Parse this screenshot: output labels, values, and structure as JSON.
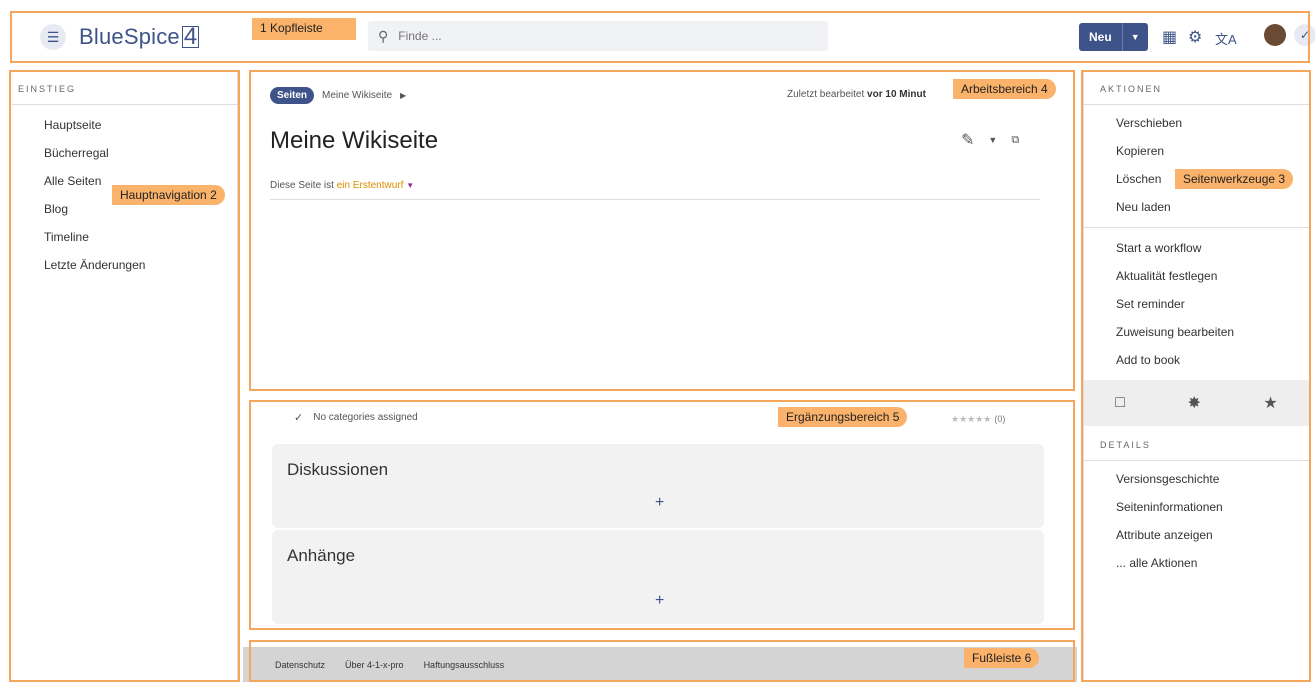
{
  "header": {
    "menu_icon": "hamburger-icon",
    "logo_text": "BlueSpice",
    "logo_number": "4",
    "search_placeholder": "Finde ...",
    "new_button": "Neu",
    "icons": [
      "apps-grid-icon",
      "gear-icon",
      "translate-icon",
      "avatar",
      "wrench-icon"
    ]
  },
  "callouts": {
    "c1": "1 Kopfleiste",
    "c2": "Hauptnavigation 2",
    "c3": "Seitenwerkzeuge 3",
    "c4": "Arbeitsbereich 4",
    "c5": "Ergänzungsbereich 5",
    "c6": "Fußleiste 6"
  },
  "left_nav": {
    "heading": "EINSTIEG",
    "items": [
      "Hauptseite",
      "Bücherregal",
      "Alle Seiten",
      "Blog",
      "Timeline",
      "Letzte Änderungen"
    ]
  },
  "main": {
    "breadcrumb_pill": "Seiten",
    "breadcrumb_page": "Meine Wikiseite",
    "last_edited_prefix": "Zuletzt bearbeitet",
    "last_edited_value": "vor 10 Minut",
    "title": "Meine Wikiseite",
    "status_prefix": "Diese Seite ist",
    "status_value": "ein Erstentwurf",
    "categories": "No categories assigned",
    "rating_count": "(0)",
    "rating_stars": 0,
    "panels": [
      {
        "title": "Diskussionen",
        "add": "+"
      },
      {
        "title": "Anhänge",
        "add": "+"
      }
    ]
  },
  "footer": {
    "links": [
      "Datenschutz",
      "Über 4-1-x-pro",
      "Haftungsausschluss"
    ]
  },
  "right": {
    "actions_heading": "AKTIONEN",
    "actions_group1": [
      "Verschieben",
      "Kopieren",
      "Löschen",
      "Neu laden"
    ],
    "actions_group2": [
      "Start a workflow",
      "Aktualität festlegen",
      "Set reminder",
      "Zuweisung bearbeiten",
      "Add to book"
    ],
    "icon_bar": [
      "page-icon",
      "share-icon",
      "star-icon"
    ],
    "details_heading": "DETAILS",
    "details": [
      "Versionsgeschichte",
      "Seiteninformationen",
      "Attribute anzeigen",
      "... alle Aktionen"
    ]
  }
}
